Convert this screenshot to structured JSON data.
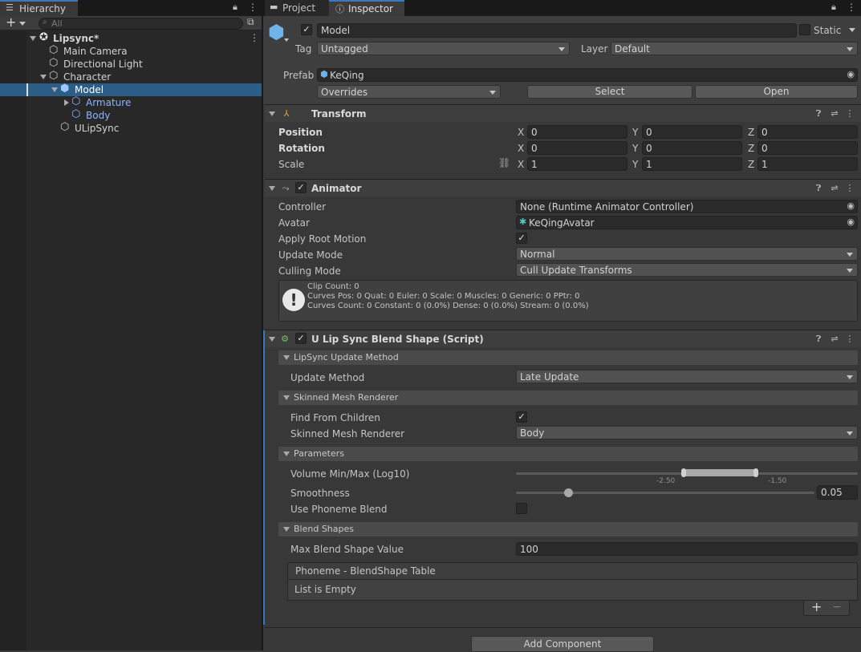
{
  "hierarchy": {
    "tab_label": "Hierarchy",
    "search_placeholder": "All",
    "scene": "Lipsync*",
    "items": [
      {
        "label": "Main Camera"
      },
      {
        "label": "Directional Light"
      },
      {
        "label": "Character"
      },
      {
        "label": "Model"
      },
      {
        "label": "Armature"
      },
      {
        "label": "Body"
      },
      {
        "label": "ULipSync"
      }
    ]
  },
  "tabs": {
    "project": "Project",
    "inspector": "Inspector"
  },
  "object": {
    "name": "Model",
    "static_label": "Static",
    "tag_label": "Tag",
    "tag_value": "Untagged",
    "layer_label": "Layer",
    "layer_value": "Default",
    "prefab_label": "Prefab",
    "prefab_value": "KeQing",
    "overrides": "Overrides",
    "select": "Select",
    "open": "Open"
  },
  "transform": {
    "title": "Transform",
    "position_label": "Position",
    "rotation_label": "Rotation",
    "scale_label": "Scale",
    "x": "X",
    "y": "Y",
    "z": "Z",
    "position": [
      "0",
      "0",
      "0"
    ],
    "rotation": [
      "0",
      "0",
      "0"
    ],
    "scale": [
      "1",
      "1",
      "1"
    ]
  },
  "animator": {
    "title": "Animator",
    "controller_label": "Controller",
    "controller_value": "None (Runtime Animator Controller)",
    "avatar_label": "Avatar",
    "avatar_value": "KeQingAvatar",
    "apply_root_label": "Apply Root Motion",
    "apply_root_checked": true,
    "update_mode_label": "Update Mode",
    "update_mode_value": "Normal",
    "culling_mode_label": "Culling Mode",
    "culling_mode_value": "Cull Update Transforms",
    "info_lines": [
      "Clip Count: 0",
      "Curves Pos: 0 Quat: 0 Euler: 0 Scale: 0 Muscles: 0 Generic: 0 PPtr: 0",
      "Curves Count: 0 Constant: 0 (0.0%) Dense: 0 (0.0%) Stream: 0 (0.0%)"
    ]
  },
  "ulipsync": {
    "title": "U Lip Sync Blend Shape (Script)",
    "section_update": "LipSync Update Method",
    "update_method_label": "Update Method",
    "update_method_value": "Late Update",
    "section_smr": "Skinned Mesh Renderer",
    "find_children_label": "Find From Children",
    "find_children_checked": true,
    "smr_label": "Skinned Mesh Renderer",
    "smr_value": "Body",
    "section_params": "Parameters",
    "volume_label": "Volume Min/Max (Log10)",
    "volume_tick_left": "-2.50",
    "volume_tick_right": "-1.50",
    "smoothness_label": "Smoothness",
    "smoothness_value": "0.05",
    "phoneme_blend_label": "Use Phoneme Blend",
    "section_blend": "Blend Shapes",
    "max_blend_label": "Max Blend Shape Value",
    "max_blend_value": "100",
    "table_title": "Phoneme - BlendShape Table",
    "table_empty": "List is Empty",
    "add_symbol": "+",
    "remove_symbol": "−"
  },
  "add_component": "Add Component"
}
